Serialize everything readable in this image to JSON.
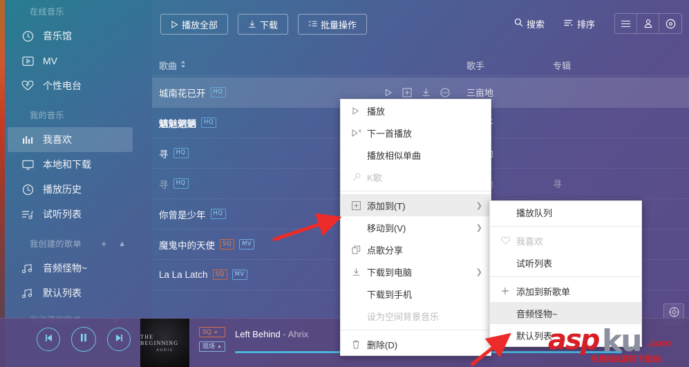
{
  "sidebar": {
    "group_online": "在线音乐",
    "group_mine": "我的音乐",
    "group_created": "我创建的歌单",
    "group_collected": "我收藏的歌单",
    "online_items": [
      {
        "label": "音乐馆",
        "icon": "compass-icon"
      },
      {
        "label": "MV",
        "icon": "video-icon"
      },
      {
        "label": "个性电台",
        "icon": "heart-radio-icon"
      }
    ],
    "mine_items": [
      {
        "label": "我喜欢",
        "icon": "bars-icon",
        "active": true
      },
      {
        "label": "本地和下载",
        "icon": "monitor-icon",
        "active": false
      },
      {
        "label": "播放历史",
        "icon": "clock-icon",
        "active": false
      },
      {
        "label": "试听列表",
        "icon": "playlist-icon",
        "active": false
      }
    ],
    "created_items": [
      {
        "label": "音频怪物~",
        "icon": "music-note-icon"
      },
      {
        "label": "默认列表",
        "icon": "music-note-icon"
      }
    ],
    "add_playlist_icon": "plus-icon",
    "collapse_icon": "chevron-up-icon"
  },
  "toolbar": {
    "play_all": "播放全部",
    "download": "下载",
    "batch": "批量操作",
    "search": "搜索",
    "sort": "排序",
    "menu_icon": "hamburger-icon",
    "user_icon": "user-icon",
    "disc_icon": "disc-icon"
  },
  "list_header": {
    "song": "歌曲",
    "artist": "歌手",
    "album": "专辑",
    "sort_icon": "sort-updown-icon"
  },
  "rows": [
    {
      "title": "城南花已开",
      "badges": [
        "HQ"
      ],
      "artist": "三亩地",
      "album": "",
      "selected": true,
      "dim": false,
      "show_actions": true
    },
    {
      "title": "魑魅魍魉",
      "badges": [
        "HQ"
      ],
      "artist": "理理子",
      "album": "",
      "selected": false,
      "dim": false,
      "show_actions": false
    },
    {
      "title": "寻",
      "badges": [
        "HQ"
      ],
      "artist": "三亩地",
      "album": "",
      "selected": false,
      "dim": false,
      "show_actions": false
    },
    {
      "title": "寻",
      "badges": [
        "HQ"
      ],
      "artist": "三亩地",
      "album": "寻",
      "selected": false,
      "dim": true,
      "show_actions": false
    },
    {
      "title": "你曾是少年",
      "badges": [
        "HQ"
      ],
      "artist": "",
      "album": "",
      "selected": false,
      "dim": false,
      "show_actions": false
    },
    {
      "title": "魔鬼中的天使",
      "badges": [
        "SQ",
        "MV"
      ],
      "artist": "",
      "album": "",
      "selected": false,
      "dim": false,
      "show_actions": false
    },
    {
      "title": "La La Latch",
      "badges": [
        "SQ",
        "MV"
      ],
      "artist": "",
      "album": "",
      "selected": false,
      "dim": false,
      "show_actions": false
    }
  ],
  "row_actions": [
    "play-icon",
    "add-icon",
    "download-icon",
    "more-icon"
  ],
  "context_menu": {
    "items": [
      {
        "label": "播放",
        "icon": "play-icon",
        "arrow": false,
        "disabled": false,
        "highlight": false
      },
      {
        "label": "下一首播放",
        "icon": "play-next-icon",
        "arrow": false,
        "disabled": false,
        "highlight": false
      },
      {
        "label": "播放相似单曲",
        "icon": "",
        "arrow": false,
        "disabled": false,
        "highlight": false
      },
      {
        "label": "K歌",
        "icon": "mic-icon",
        "arrow": false,
        "disabled": true,
        "highlight": false
      },
      {
        "sep": true
      },
      {
        "label": "添加到(T)",
        "icon": "plus-box-icon",
        "arrow": true,
        "disabled": false,
        "highlight": true
      },
      {
        "label": "移动到(V)",
        "icon": "",
        "arrow": true,
        "disabled": false,
        "highlight": false
      },
      {
        "label": "点歌分享",
        "icon": "share-icon",
        "arrow": false,
        "disabled": false,
        "highlight": false
      },
      {
        "label": "下载到电脑",
        "icon": "download-icon",
        "arrow": true,
        "disabled": false,
        "highlight": false
      },
      {
        "label": "下载到手机",
        "icon": "",
        "arrow": false,
        "disabled": false,
        "highlight": false
      },
      {
        "label": "设为空间背景音乐",
        "icon": "",
        "arrow": false,
        "disabled": true,
        "highlight": false
      },
      {
        "sep": true
      },
      {
        "label": "删除(D)",
        "icon": "trash-icon",
        "arrow": false,
        "disabled": false,
        "highlight": false
      }
    ]
  },
  "submenu": {
    "items": [
      {
        "label": "播放队列",
        "icon": "",
        "disabled": false,
        "highlight": false
      },
      {
        "sep": true
      },
      {
        "label": "我喜欢",
        "icon": "heart-icon",
        "disabled": true,
        "highlight": false
      },
      {
        "label": "试听列表",
        "icon": "",
        "disabled": false,
        "highlight": false
      },
      {
        "sep": true
      },
      {
        "label": "添加到新歌单",
        "icon": "plus-icon",
        "disabled": false,
        "highlight": false
      },
      {
        "label": "音频怪物~",
        "icon": "",
        "disabled": false,
        "highlight": true
      },
      {
        "label": "默认列表",
        "icon": "",
        "disabled": false,
        "highlight": false
      }
    ]
  },
  "player": {
    "prev_icon": "prev-icon",
    "pause_icon": "pause-icon",
    "next_icon": "next-icon",
    "cover_title": "THE BEGINNING",
    "cover_artist": "AHRIX",
    "quality_tag": "SQ",
    "live_tag": "现场",
    "song_title": "Left Behind",
    "separator": "-",
    "song_artist": "Ahrix",
    "settings_icon": "gear-icon"
  },
  "watermark": {
    "part1": "asp",
    "part2": "ku",
    "part3": ".com",
    "tagline": "免费网站源码下载站!"
  }
}
